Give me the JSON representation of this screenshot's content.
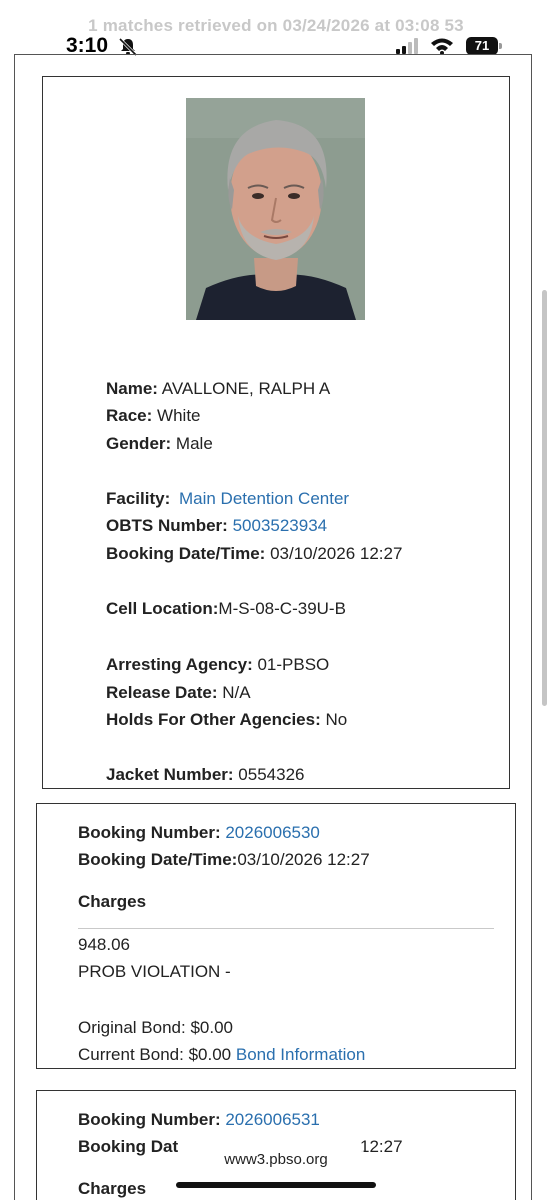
{
  "header": {
    "retrieved_text": "1 matches retrieved on 03/24/2026 at 03:08 53"
  },
  "status_bar": {
    "time": "3:10",
    "battery": "71"
  },
  "inmate": {
    "name_label": "Name:",
    "name": "AVALLONE, RALPH A",
    "race_label": "Race:",
    "race": "White",
    "gender_label": "Gender:",
    "gender": "Male",
    "facility_label": "Facility:",
    "facility": "Main Detention Center",
    "obts_label": "OBTS Number:",
    "obts": "5003523934",
    "booking_dt_label": "Booking Date/Time:",
    "booking_dt": "03/10/2026 12:27",
    "cell_label": "Cell Location:",
    "cell": "M-S-08-C-39U-B",
    "agency_label": "Arresting Agency:",
    "agency": "01-PBSO",
    "release_label": "Release Date:",
    "release": "N/A",
    "holds_label": "Holds For Other Agencies:",
    "holds": "No",
    "jacket_label": "Jacket Number:",
    "jacket": "0554326"
  },
  "bookings": [
    {
      "number_label": "Booking Number:",
      "number": "2026006530",
      "dt_label": "Booking Date/Time:",
      "dt": "03/10/2026 12:27",
      "charges_label": "Charges",
      "statute": "948.06",
      "charge": "PROB VIOLATION -",
      "original_bond_label": "Original Bond:",
      "original_bond": "$0.00",
      "current_bond_label": "Current Bond:",
      "current_bond": "$0.00",
      "bond_info_link": "Bond Information"
    },
    {
      "number_label": "Booking Number:",
      "number": "2026006531",
      "dt_label": "Booking Dat",
      "dt": "12:27",
      "charges_label": "Charges"
    }
  ],
  "browser": {
    "url": "www3.pbso.org"
  }
}
